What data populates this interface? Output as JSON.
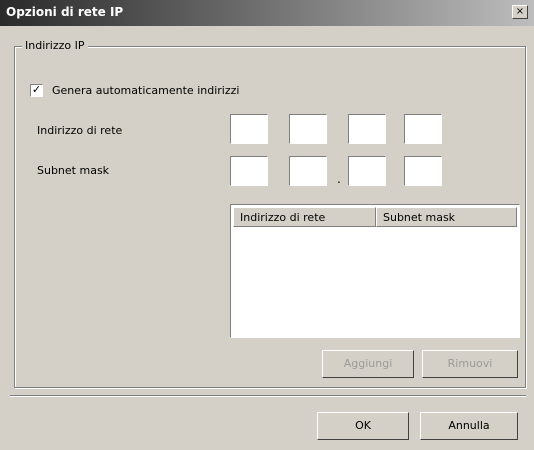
{
  "window": {
    "title": "Opzioni di rete IP",
    "close_glyph": "×"
  },
  "group": {
    "legend": "Indirizzo IP",
    "checkbox": {
      "label": "Genera automaticamente indirizzi",
      "checked": true,
      "mark": "✓"
    },
    "ip_label": "Indirizzo di rete",
    "mask_label": "Subnet mask",
    "dot": ".",
    "list": {
      "col1": "Indirizzo di rete",
      "col2": "Subnet mask"
    },
    "add_button": "Aggiungi",
    "remove_button": "Rimuovi"
  },
  "footer": {
    "ok_button": "OK",
    "cancel_button": "Annulla"
  }
}
